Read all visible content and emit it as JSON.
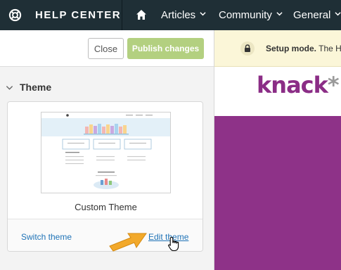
{
  "topbar": {
    "title": "HELP CENTER",
    "nav": [
      {
        "label": "Articles"
      },
      {
        "label": "Community"
      },
      {
        "label": "General"
      }
    ],
    "colors": {
      "background": "#1f2f36",
      "text": "#ffffff"
    }
  },
  "panel": {
    "close_label": "Close",
    "publish_label": "Publish changes",
    "section_title": "Theme",
    "card": {
      "theme_name": "Custom Theme",
      "switch_label": "Switch theme",
      "edit_label": "Edit theme"
    },
    "colors": {
      "publish": "#b3d080",
      "link": "#1f73b7"
    }
  },
  "preview": {
    "setup_bold": "Setup mode.",
    "setup_rest": " The H",
    "logo_text": "knack",
    "logo_star": "*",
    "colors": {
      "banner": "#fbf6d8",
      "brand": "#8b2d86",
      "hero": "#8e3288"
    }
  },
  "icons": [
    "lifebuoy-icon",
    "home-icon",
    "chevron-down-icon",
    "lock-icon",
    "arrow-pointer-icon",
    "hand-cursor-icon"
  ]
}
